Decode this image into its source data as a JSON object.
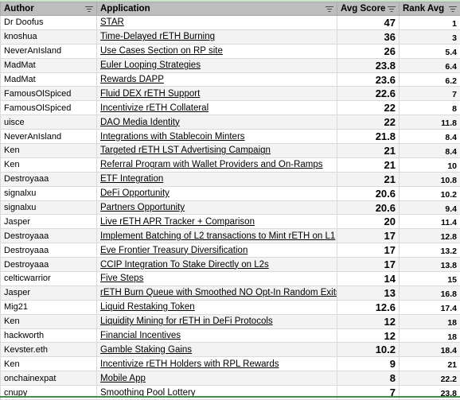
{
  "header": {
    "columns": [
      {
        "label": "Author",
        "icon": "filter-icon"
      },
      {
        "label": "Application",
        "icon": "filter-icon"
      },
      {
        "label": "Avg Score",
        "icon": "filter-icon"
      },
      {
        "label": "Rank Avg",
        "icon": "filter-icon"
      }
    ]
  },
  "rows": [
    {
      "author": "Dr Doofus",
      "application": "STAR",
      "avg_score": "47",
      "rank_avg": "1"
    },
    {
      "author": "knoshua",
      "application": "Time-Delayed rETH Burning",
      "avg_score": "36",
      "rank_avg": "3"
    },
    {
      "author": "NeverAnIsland",
      "application": "Use Cases Section on RP site",
      "avg_score": "26",
      "rank_avg": "5.4"
    },
    {
      "author": "MadMat",
      "application": "Euler Looping Strategies",
      "avg_score": "23.8",
      "rank_avg": "6.4"
    },
    {
      "author": "MadMat",
      "application": "Rewards DAPP",
      "avg_score": "23.6",
      "rank_avg": "6.2"
    },
    {
      "author": "FamousOlSpiced",
      "application": "Fluid DEX rETH Support",
      "avg_score": "22.6",
      "rank_avg": "7"
    },
    {
      "author": "FamousOlSpiced",
      "application": "Incentivize rETH Collateral",
      "avg_score": "22",
      "rank_avg": "8"
    },
    {
      "author": "uisce",
      "application": "DAO Media Identity",
      "avg_score": "22",
      "rank_avg": "11.8"
    },
    {
      "author": "NeverAnIsland",
      "application": "Integrations with Stablecoin Minters",
      "avg_score": "21.8",
      "rank_avg": "8.4"
    },
    {
      "author": "Ken",
      "application": "Targeted rETH LST Advertising Campaign",
      "avg_score": "21",
      "rank_avg": "8.4"
    },
    {
      "author": "Ken",
      "application": "Referral Program with Wallet Providers and On-Ramps",
      "avg_score": "21",
      "rank_avg": "10"
    },
    {
      "author": "Destroyaaa",
      "application": "ETF Integration",
      "avg_score": "21",
      "rank_avg": "10.8"
    },
    {
      "author": "signalxu",
      "application": "DeFi Opportunity",
      "avg_score": "20.6",
      "rank_avg": "10.2"
    },
    {
      "author": "signalxu",
      "application": "Partners Opportunity",
      "avg_score": "20.6",
      "rank_avg": "9.4"
    },
    {
      "author": "Jasper",
      "application": "Live rETH APR Tracker + Comparison",
      "avg_score": "20",
      "rank_avg": "11.4"
    },
    {
      "author": "Destroyaaa",
      "application": "Implement Batching of L2 transactions to Mint rETH on L1",
      "avg_score": "17",
      "rank_avg": "12.8"
    },
    {
      "author": "Destroyaaa",
      "application": "Eve Frontier Treasury Diversification",
      "avg_score": "17",
      "rank_avg": "13.2"
    },
    {
      "author": "Destroyaaa",
      "application": "CCIP Integration To Stake Directly on L2s",
      "avg_score": "17",
      "rank_avg": "13.8"
    },
    {
      "author": "celticwarrior",
      "application": "Five Steps",
      "avg_score": "14",
      "rank_avg": "15"
    },
    {
      "author": "Jasper",
      "application": "rETH Burn Queue with Smoothed NO Opt-In Random Exits",
      "avg_score": "13",
      "rank_avg": "16.8"
    },
    {
      "author": "Mig21",
      "application": "Liquid Restaking Token",
      "avg_score": "12.6",
      "rank_avg": "17.4"
    },
    {
      "author": "Ken",
      "application": "Liquidity Mining for rETH in DeFi Protocols",
      "avg_score": "12",
      "rank_avg": "18"
    },
    {
      "author": "hackworth",
      "application": "Financial Incentives",
      "avg_score": "12",
      "rank_avg": "18"
    },
    {
      "author": "Kevster.eth",
      "application": "Gamble Staking Gains",
      "avg_score": "10.2",
      "rank_avg": "18.4"
    },
    {
      "author": "Ken",
      "application": "Incentivize rETH Holders with RPL Rewards",
      "avg_score": "9",
      "rank_avg": "21"
    },
    {
      "author": "onchainexpat",
      "application": "Mobile App",
      "avg_score": "8",
      "rank_avg": "22.2"
    },
    {
      "author": "cnupy",
      "application": "Smoothing Pool Lottery",
      "avg_score": "7",
      "rank_avg": "23.8"
    }
  ],
  "colors": {
    "header_bg": "#bdbdbd",
    "stripe_bg": "#f3f3f3",
    "grid_line": "#dadada",
    "bottom_border": "#4a8a4a"
  }
}
